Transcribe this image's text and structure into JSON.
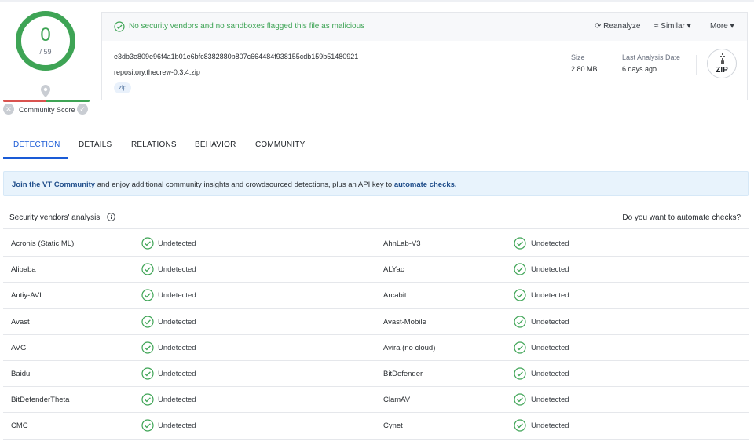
{
  "score": {
    "value": "0",
    "total": "/ 59",
    "community_label": "Community Score"
  },
  "banner": {
    "message": "No security vendors and no sandboxes flagged this file as malicious"
  },
  "actions": {
    "reanalyze": "Reanalyze",
    "similar": "Similar",
    "more": "More"
  },
  "file": {
    "hash": "e3db3e809e96f4a1b01e6bfc8382880b807c664484f938155cdb159b51480921",
    "name": "repository.thecrew-0.3.4.zip",
    "tag": "zip",
    "size_label": "Size",
    "size_value": "2.80 MB",
    "date_label": "Last Analysis Date",
    "date_value": "6 days ago",
    "type_icon_label": "ZIP"
  },
  "tabs": [
    "DETECTION",
    "DETAILS",
    "RELATIONS",
    "BEHAVIOR",
    "COMMUNITY"
  ],
  "join": {
    "link1": "Join the VT Community",
    "text": " and enjoy additional community insights and crowdsourced detections, plus an API key to ",
    "link2": "automate checks."
  },
  "vendors_header": {
    "title": "Security vendors' analysis",
    "automate": "Do you want to automate checks?"
  },
  "vendors": [
    {
      "left": "Acronis (Static ML)",
      "left_result": "Undetected",
      "right": "AhnLab-V3",
      "right_result": "Undetected"
    },
    {
      "left": "Alibaba",
      "left_result": "Undetected",
      "right": "ALYac",
      "right_result": "Undetected"
    },
    {
      "left": "Antiy-AVL",
      "left_result": "Undetected",
      "right": "Arcabit",
      "right_result": "Undetected"
    },
    {
      "left": "Avast",
      "left_result": "Undetected",
      "right": "Avast-Mobile",
      "right_result": "Undetected"
    },
    {
      "left": "AVG",
      "left_result": "Undetected",
      "right": "Avira (no cloud)",
      "right_result": "Undetected"
    },
    {
      "left": "Baidu",
      "left_result": "Undetected",
      "right": "BitDefender",
      "right_result": "Undetected"
    },
    {
      "left": "BitDefenderTheta",
      "left_result": "Undetected",
      "right": "ClamAV",
      "right_result": "Undetected"
    },
    {
      "left": "CMC",
      "left_result": "Undetected",
      "right": "Cynet",
      "right_result": "Undetected"
    }
  ],
  "colors": {
    "clean": "#3ea455",
    "accent": "#1a5bd6",
    "banner_bg": "#e8f3fc"
  },
  "icons": {
    "check": "check-circle-icon",
    "reanalyze": "refresh-icon",
    "similar": "similar-icon",
    "dropdown": "caret-down-icon",
    "info": "info-icon"
  }
}
